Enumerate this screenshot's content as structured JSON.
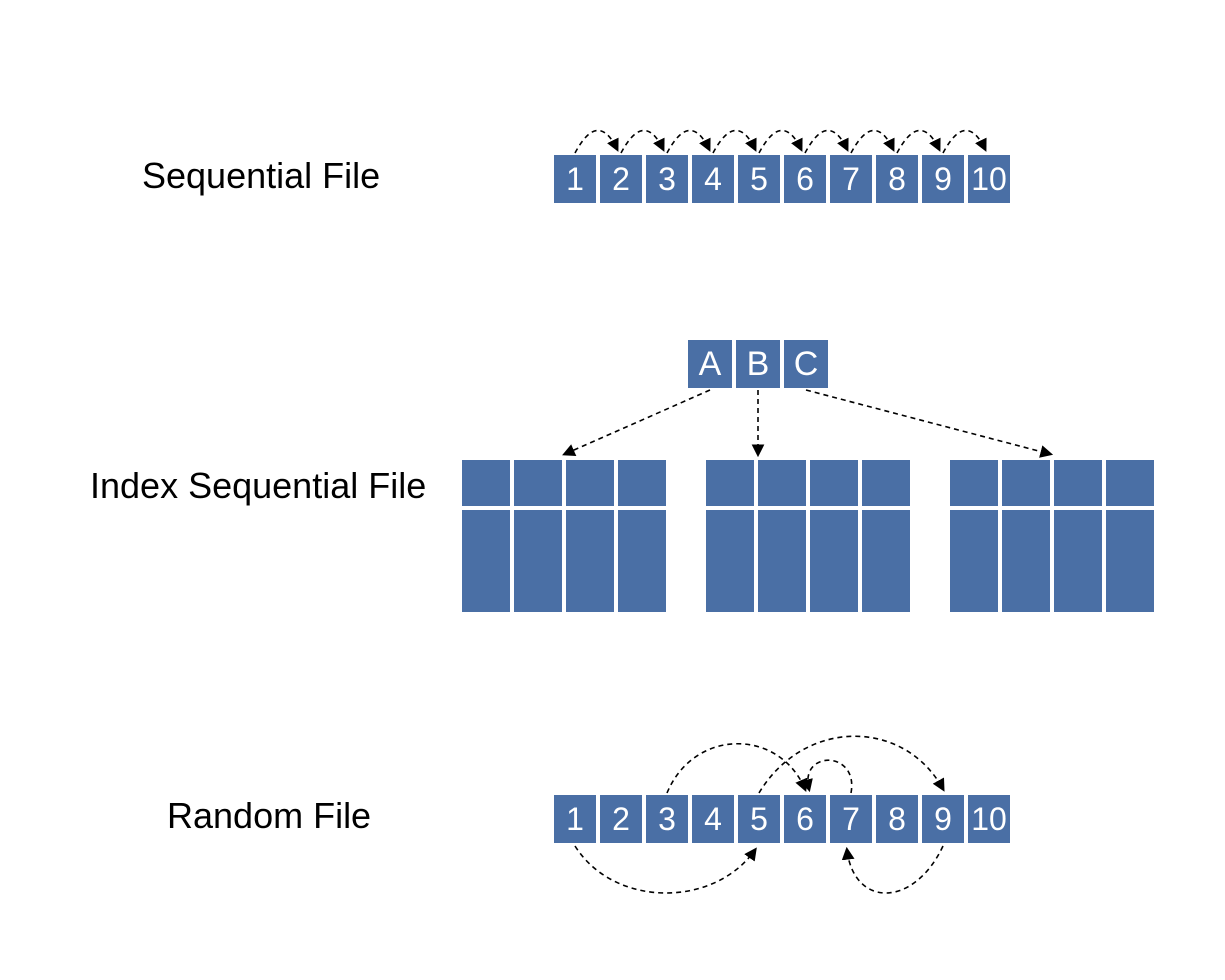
{
  "sections": {
    "sequential": {
      "label": "Sequential File",
      "cells": [
        "1",
        "2",
        "3",
        "4",
        "5",
        "6",
        "7",
        "8",
        "9",
        "10"
      ]
    },
    "indexed": {
      "label": "Index Sequential File",
      "index_cells": [
        "A",
        "B",
        "C"
      ]
    },
    "random": {
      "label": "Random File",
      "cells": [
        "1",
        "2",
        "3",
        "4",
        "5",
        "6",
        "7",
        "8",
        "9",
        "10"
      ]
    }
  },
  "colors": {
    "cell_bg": "#4a6fa5",
    "cell_fg": "#ffffff",
    "stroke": "#000000"
  }
}
